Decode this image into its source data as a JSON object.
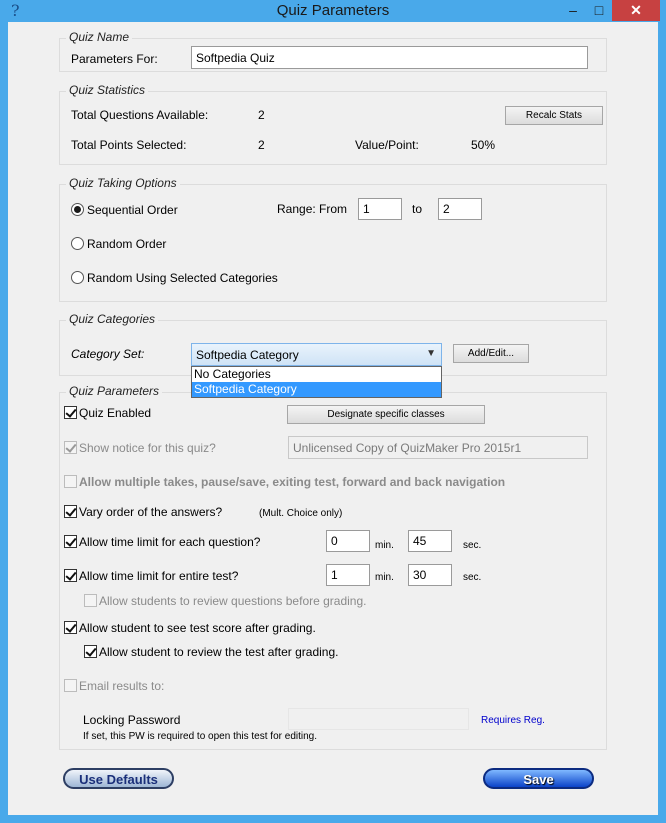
{
  "window": {
    "title": "Quiz Parameters",
    "help_icon": "?",
    "minimize": "–",
    "maximize": "□",
    "close": "✕"
  },
  "quiz_name": {
    "group_title": "Quiz Name",
    "label": "Parameters For:",
    "value": "Softpedia Quiz"
  },
  "quiz_stats": {
    "group_title": "Quiz Statistics",
    "total_questions_label": "Total Questions Available:",
    "total_questions_value": "2",
    "recalc_button": "Recalc Stats",
    "total_points_label": "Total Points Selected:",
    "total_points_value": "2",
    "value_point_label": "Value/Point:",
    "value_point_value": "50%"
  },
  "taking_options": {
    "group_title": "Quiz Taking Options",
    "sequential": "Sequential Order",
    "random": "Random Order",
    "random_categories": "Random Using Selected Categories",
    "range_label": "Range:",
    "from_label": "From",
    "from_value": "1",
    "to_label": "to",
    "to_value": "2"
  },
  "categories": {
    "group_title": "Quiz Categories",
    "set_label": "Category Set:",
    "selected": "Softpedia Category",
    "options": [
      "No Categories",
      "Softpedia Category"
    ],
    "add_edit_button": "Add/Edit..."
  },
  "params": {
    "group_title": "Quiz Parameters",
    "quiz_enabled": "Quiz Enabled",
    "designate_button": "Designate specific classes",
    "show_notice": "Show notice for this quiz?",
    "notice_value": "Unlicensed Copy of QuizMaker Pro 2015r1",
    "allow_multiple": "Allow multiple takes, pause/save, exiting test, forward and back navigation",
    "vary_order": "Vary order of the answers?",
    "vary_order_note": "(Mult. Choice only)",
    "time_each": "Allow time limit for each question?",
    "time_each_min": "0",
    "time_each_sec": "45",
    "time_entire": "Allow time limit for entire test?",
    "time_entire_min": "1",
    "time_entire_sec": "30",
    "min_label": "min.",
    "sec_label": "sec.",
    "review_before": "Allow students to review questions before grading.",
    "see_score": "Allow student to see test score after grading.",
    "review_after": "Allow student to review the test after grading.",
    "email_results": "Email results to:",
    "locking_password": "Locking Password",
    "locking_note": "If set, this PW is required to open this test for editing.",
    "requires_reg": "Requires Reg."
  },
  "footer": {
    "use_defaults": "Use Defaults",
    "save": "Save"
  },
  "colors": {
    "title_bar": "#49a9ea",
    "dialog_bg": "#f0f0f0",
    "selection": "#3399ff",
    "link": "#0000cc"
  }
}
